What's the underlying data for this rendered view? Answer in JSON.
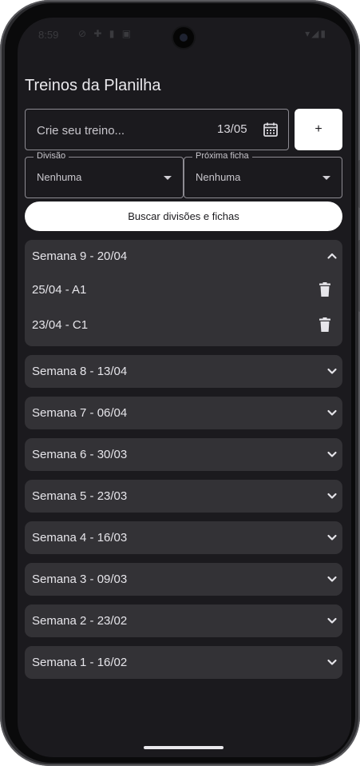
{
  "status": {
    "time": "8:59",
    "icons": "⊘ ✚ ▮ ▣",
    "right_icons": "▾◢▮"
  },
  "app": {
    "title": "Treinos da Planilha"
  },
  "new_workout": {
    "placeholder": "Crie seu treino...",
    "date": "13/05",
    "add_label": "+"
  },
  "filters": {
    "division": {
      "legend": "Divisão",
      "value": "Nenhuma"
    },
    "next_sheet": {
      "legend": "Próxima ficha",
      "value": "Nenhuma"
    }
  },
  "search_button": "Buscar divisões e fichas",
  "weeks": [
    {
      "label": "Semana 9 - 20/04",
      "expanded": true,
      "items": [
        {
          "label": "25/04 - A1"
        },
        {
          "label": "23/04 - C1"
        }
      ]
    },
    {
      "label": "Semana 8 - 13/04",
      "expanded": false
    },
    {
      "label": "Semana 7 - 06/04",
      "expanded": false
    },
    {
      "label": "Semana 6 - 30/03",
      "expanded": false
    },
    {
      "label": "Semana 5 - 23/03",
      "expanded": false
    },
    {
      "label": "Semana 4 - 16/03",
      "expanded": false
    },
    {
      "label": "Semana 3 - 09/03",
      "expanded": false
    },
    {
      "label": "Semana 2 - 23/02",
      "expanded": false
    },
    {
      "label": "Semana 1 - 16/02",
      "expanded": false
    }
  ],
  "colors": {
    "background": "#1b1a1e",
    "card": "#333236",
    "text": "#e6e5ea",
    "button": "#ffffff"
  }
}
